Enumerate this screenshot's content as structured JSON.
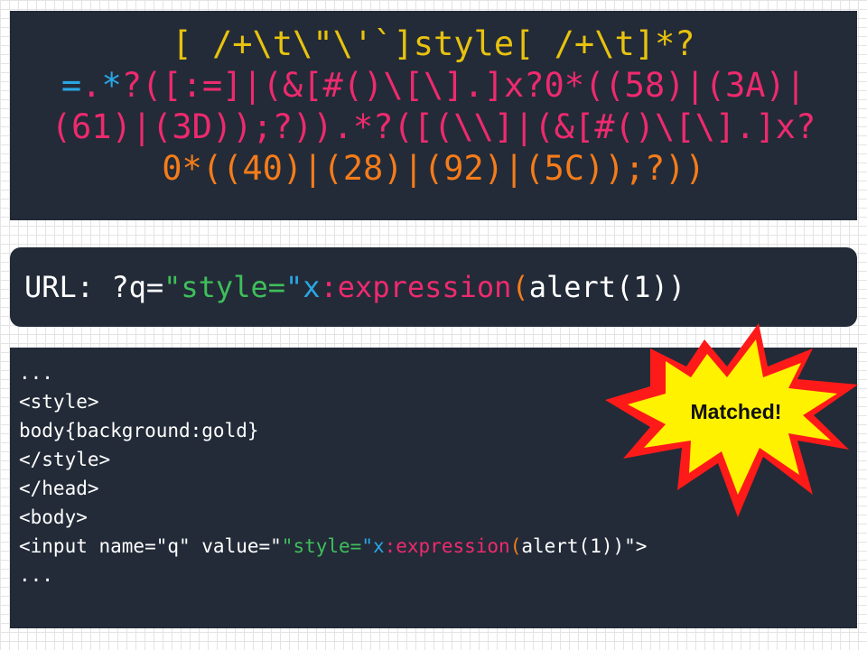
{
  "colors": {
    "yellow": "#e8c20e",
    "orange": "#f57c1a",
    "pink": "#ee2a6e",
    "cyan": "#2aa6e4",
    "green": "#3fbf5a",
    "white": "#ffffff",
    "panel_bg": "#232b38"
  },
  "regex_lines": [
    [
      {
        "t": "[ /+\\t\\\"\\'`]style[ /+\\t]*?",
        "c": "yellow"
      }
    ],
    [
      {
        "t": "=",
        "c": "cyan"
      },
      {
        "t": ".",
        "c": "pink"
      },
      {
        "t": "*",
        "c": "cyan"
      },
      {
        "t": "?([:=]|(&[#()\\[\\].]x?0*((58)|(3A)|",
        "c": "pink"
      }
    ],
    [
      {
        "t": "(61)|(3D));?)).",
        "c": "pink"
      },
      {
        "t": "*?([(\\\\]|(&[#()\\[\\].]x?",
        "c": "pink"
      }
    ],
    [
      {
        "t": "0*((40)|(28)|(92)|(5C));?))",
        "c": "orange"
      }
    ]
  ],
  "url_bar": [
    {
      "t": "URL: ?q=",
      "c": "white"
    },
    {
      "t": "\"style=",
      "c": "green"
    },
    {
      "t": "\"x",
      "c": "cyan"
    },
    {
      "t": ":",
      "c": "pink"
    },
    {
      "t": "expression",
      "c": "pink"
    },
    {
      "t": "(",
      "c": "orange"
    },
    {
      "t": "alert(1))",
      "c": "white"
    }
  ],
  "code_lines": [
    [
      {
        "t": "...",
        "c": "white"
      }
    ],
    [
      {
        "t": "<style>",
        "c": "white"
      }
    ],
    [
      {
        "t": "body{background:gold}",
        "c": "white"
      }
    ],
    [
      {
        "t": "</style>",
        "c": "white"
      }
    ],
    [
      {
        "t": "</head>",
        "c": "white"
      }
    ],
    [
      {
        "t": "<body>",
        "c": "white"
      }
    ],
    [
      {
        "t": "<input name=\"q\" value=\"",
        "c": "white"
      },
      {
        "t": "\"style=",
        "c": "green"
      },
      {
        "t": "\"x",
        "c": "cyan"
      },
      {
        "t": ":expression",
        "c": "pink"
      },
      {
        "t": "(",
        "c": "orange"
      },
      {
        "t": "alert(1))\">",
        "c": "white"
      }
    ],
    [
      {
        "t": "...",
        "c": "white"
      }
    ]
  ],
  "burst_label": "Matched!"
}
